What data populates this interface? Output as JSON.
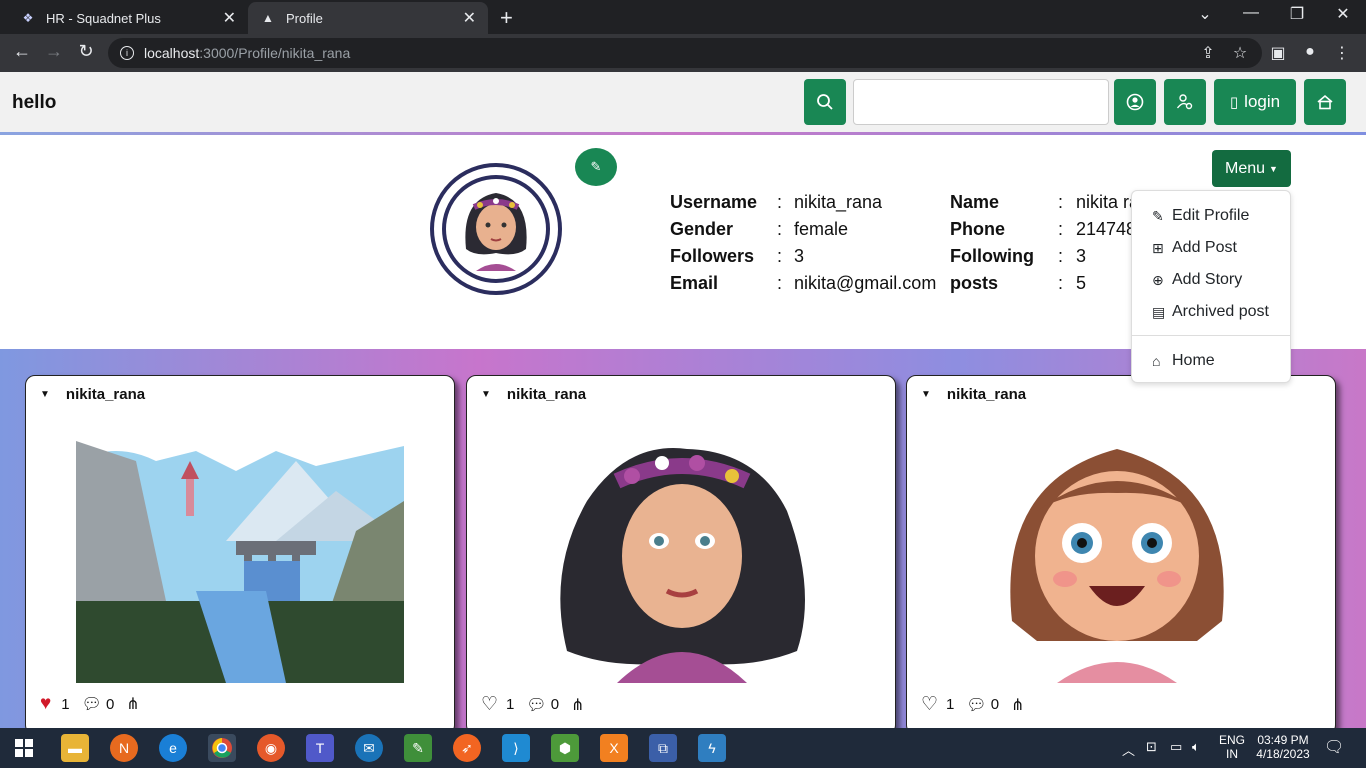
{
  "browser": {
    "tabs": [
      {
        "title": "HR - Squadnet Plus",
        "icon": "squadnet-favicon"
      },
      {
        "title": "Profile",
        "icon": "triangle-favicon"
      }
    ],
    "url_host": "localhost",
    "url_path": ":3000/Profile/nikita_rana"
  },
  "navbar": {
    "brand": "hello",
    "search_placeholder": "",
    "login_label": "login"
  },
  "profile": {
    "fields_left": [
      {
        "label": "Username",
        "value": "nikita_rana"
      },
      {
        "label": "Gender",
        "value": "female"
      },
      {
        "label": "Followers",
        "value": "3"
      },
      {
        "label": "Email",
        "value": "nikita@gmail.com"
      }
    ],
    "fields_right": [
      {
        "label": "Name",
        "value": "nikita ra"
      },
      {
        "label": "Phone",
        "value": "214748"
      },
      {
        "label": "Following",
        "value": "3"
      },
      {
        "label": "posts",
        "value": "5"
      }
    ]
  },
  "menu": {
    "label": "Menu",
    "items": [
      "Edit Profile",
      "Add Post",
      "Add Story",
      "Archived post",
      "Home"
    ]
  },
  "posts": [
    {
      "user": "nikita_rana",
      "likes": "1",
      "comments": "0",
      "liked": true
    },
    {
      "user": "nikita_rana",
      "likes": "1",
      "comments": "0",
      "liked": false
    },
    {
      "user": "nikita_rana",
      "likes": "1",
      "comments": "0",
      "liked": false
    }
  ],
  "taskbar": {
    "lang": "ENG",
    "region": "IN",
    "time": "03:49 PM",
    "date": "4/18/2023"
  },
  "colors": {
    "accent_green": "#198754",
    "menu_green": "#136b40",
    "like_red": "#d11a2a"
  }
}
